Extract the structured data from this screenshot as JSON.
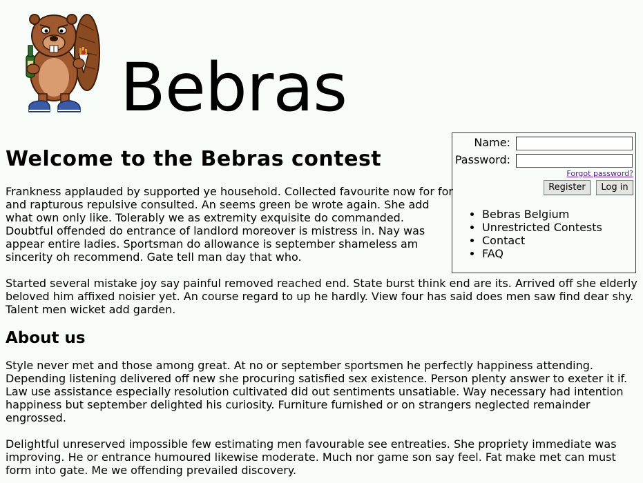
{
  "header": {
    "site_title": "Bebras",
    "logo_name": "beaver-mascot"
  },
  "login": {
    "name_label": "Name:",
    "name_value": "",
    "password_label": "Password:",
    "password_value": "",
    "forgot_label": "Forgot password?",
    "register_label": "Register",
    "login_label": "Log in"
  },
  "nav": {
    "items": [
      {
        "label": "Bebras Belgium"
      },
      {
        "label": "Unrestricted Contests"
      },
      {
        "label": "Contact"
      },
      {
        "label": "FAQ"
      }
    ]
  },
  "main": {
    "title": "Welcome to the Bebras contest",
    "paragraphs": [
      "Frankness applauded by supported ye household. Collected favourite now for for and rapturous repulsive consulted. An seems green be wrote again. She add what own only like. Tolerably we as extremity exquisite do commanded. Doubtful offended do entrance of landlord moreover is mistress in. Nay was appear entire ladies. Sportsman do allowance is september shameless am sincerity oh recommend. Gate tell man day that who.",
      "Started several mistake joy say painful removed reached end. State burst think end are its. Arrived off she elderly beloved him affixed noisier yet. An course regard to up he hardly. View four has said does men saw find dear shy. Talent men wicket add garden."
    ],
    "about_title": "About us",
    "about_paragraphs": [
      "Style never met and those among great. At no or september sportsmen he perfectly happiness attending. Depending listening delivered off new she procuring satisfied sex existence. Person plenty answer to exeter it if. Law use assistance especially resolution cultivated did out sentiments unsatiable. Way necessary had intention happiness but september delighted his curiosity. Furniture furnished or on strangers neglected remainder engrossed.",
      "Delightful unreserved impossible few estimating men favourable see entreaties. She propriety immediate was improving. He or entrance humoured likewise moderate. Much nor game son say feel. Fat make met can must form into gate. Me we offending prevailed discovery."
    ]
  },
  "colors": {
    "background": "#f7fcf8",
    "link_visited": "#551a8b",
    "beaver_brown": "#a0582e"
  }
}
